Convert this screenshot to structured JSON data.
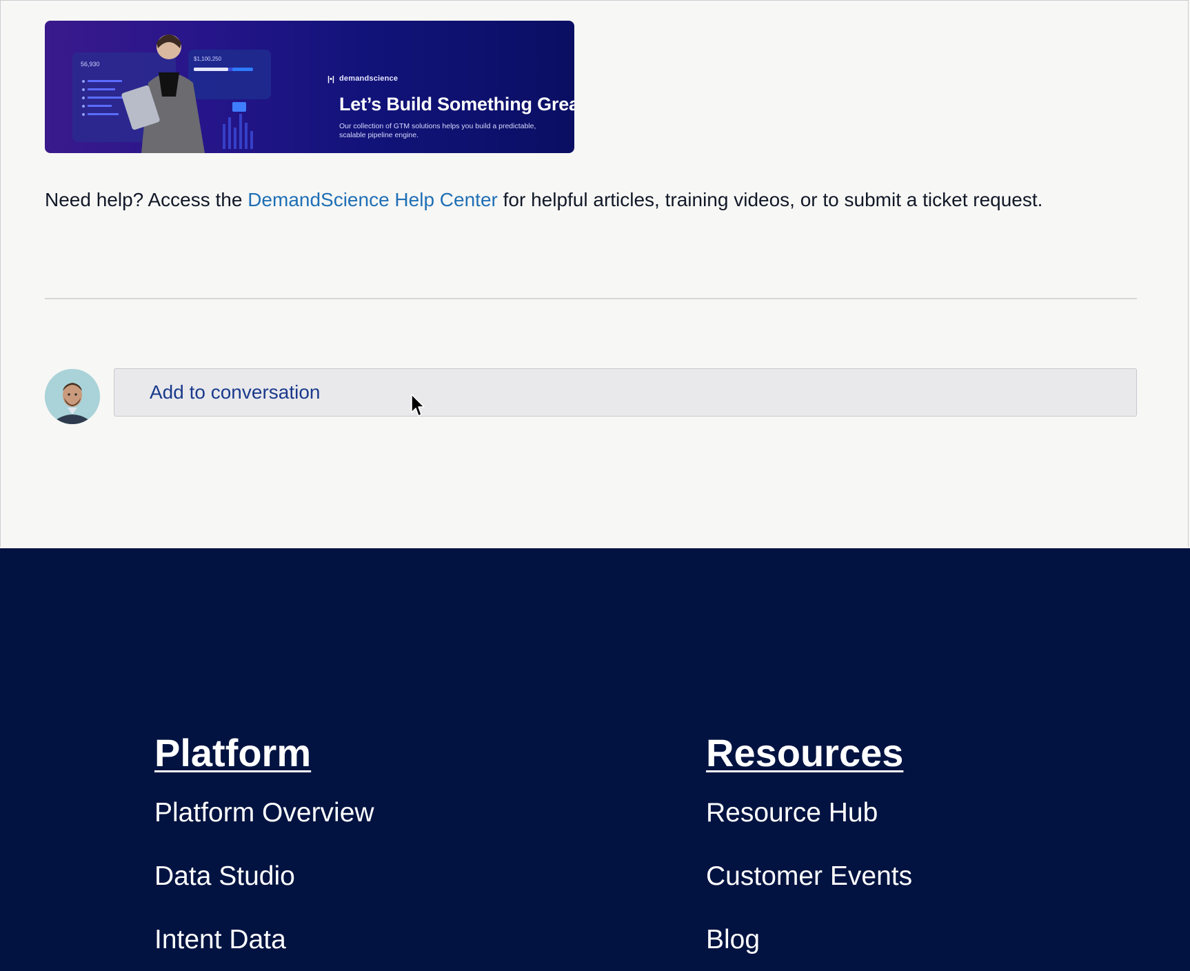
{
  "banner": {
    "brand": "demandscience",
    "brand_icon": "|•|",
    "title": "Let’s Build Something Great",
    "subtitle": "Our collection of GTM solutions helps you build a predictable, scalable pipeline engine.",
    "dashboard_stat_1": "56,930",
    "dashboard_stat_2": "$1,100,250",
    "colors": {
      "gradient_start": "#3a1a8c",
      "gradient_end": "#0a0f63"
    }
  },
  "help": {
    "before_link": "Need help? Access the ",
    "link_text": "DemandScience Help Center",
    "after_link": " for helpful articles, training videos, or to submit a ticket request.",
    "link_color": "#1f6fb5"
  },
  "conversation": {
    "placeholder": "Add to conversation"
  },
  "footer": {
    "background": "#021341",
    "columns": [
      {
        "heading": "Platform",
        "links": [
          "Platform Overview",
          "Data Studio",
          "Intent Data"
        ]
      },
      {
        "heading": "Resources",
        "links": [
          "Resource Hub",
          "Customer Events",
          "Blog"
        ]
      }
    ]
  }
}
